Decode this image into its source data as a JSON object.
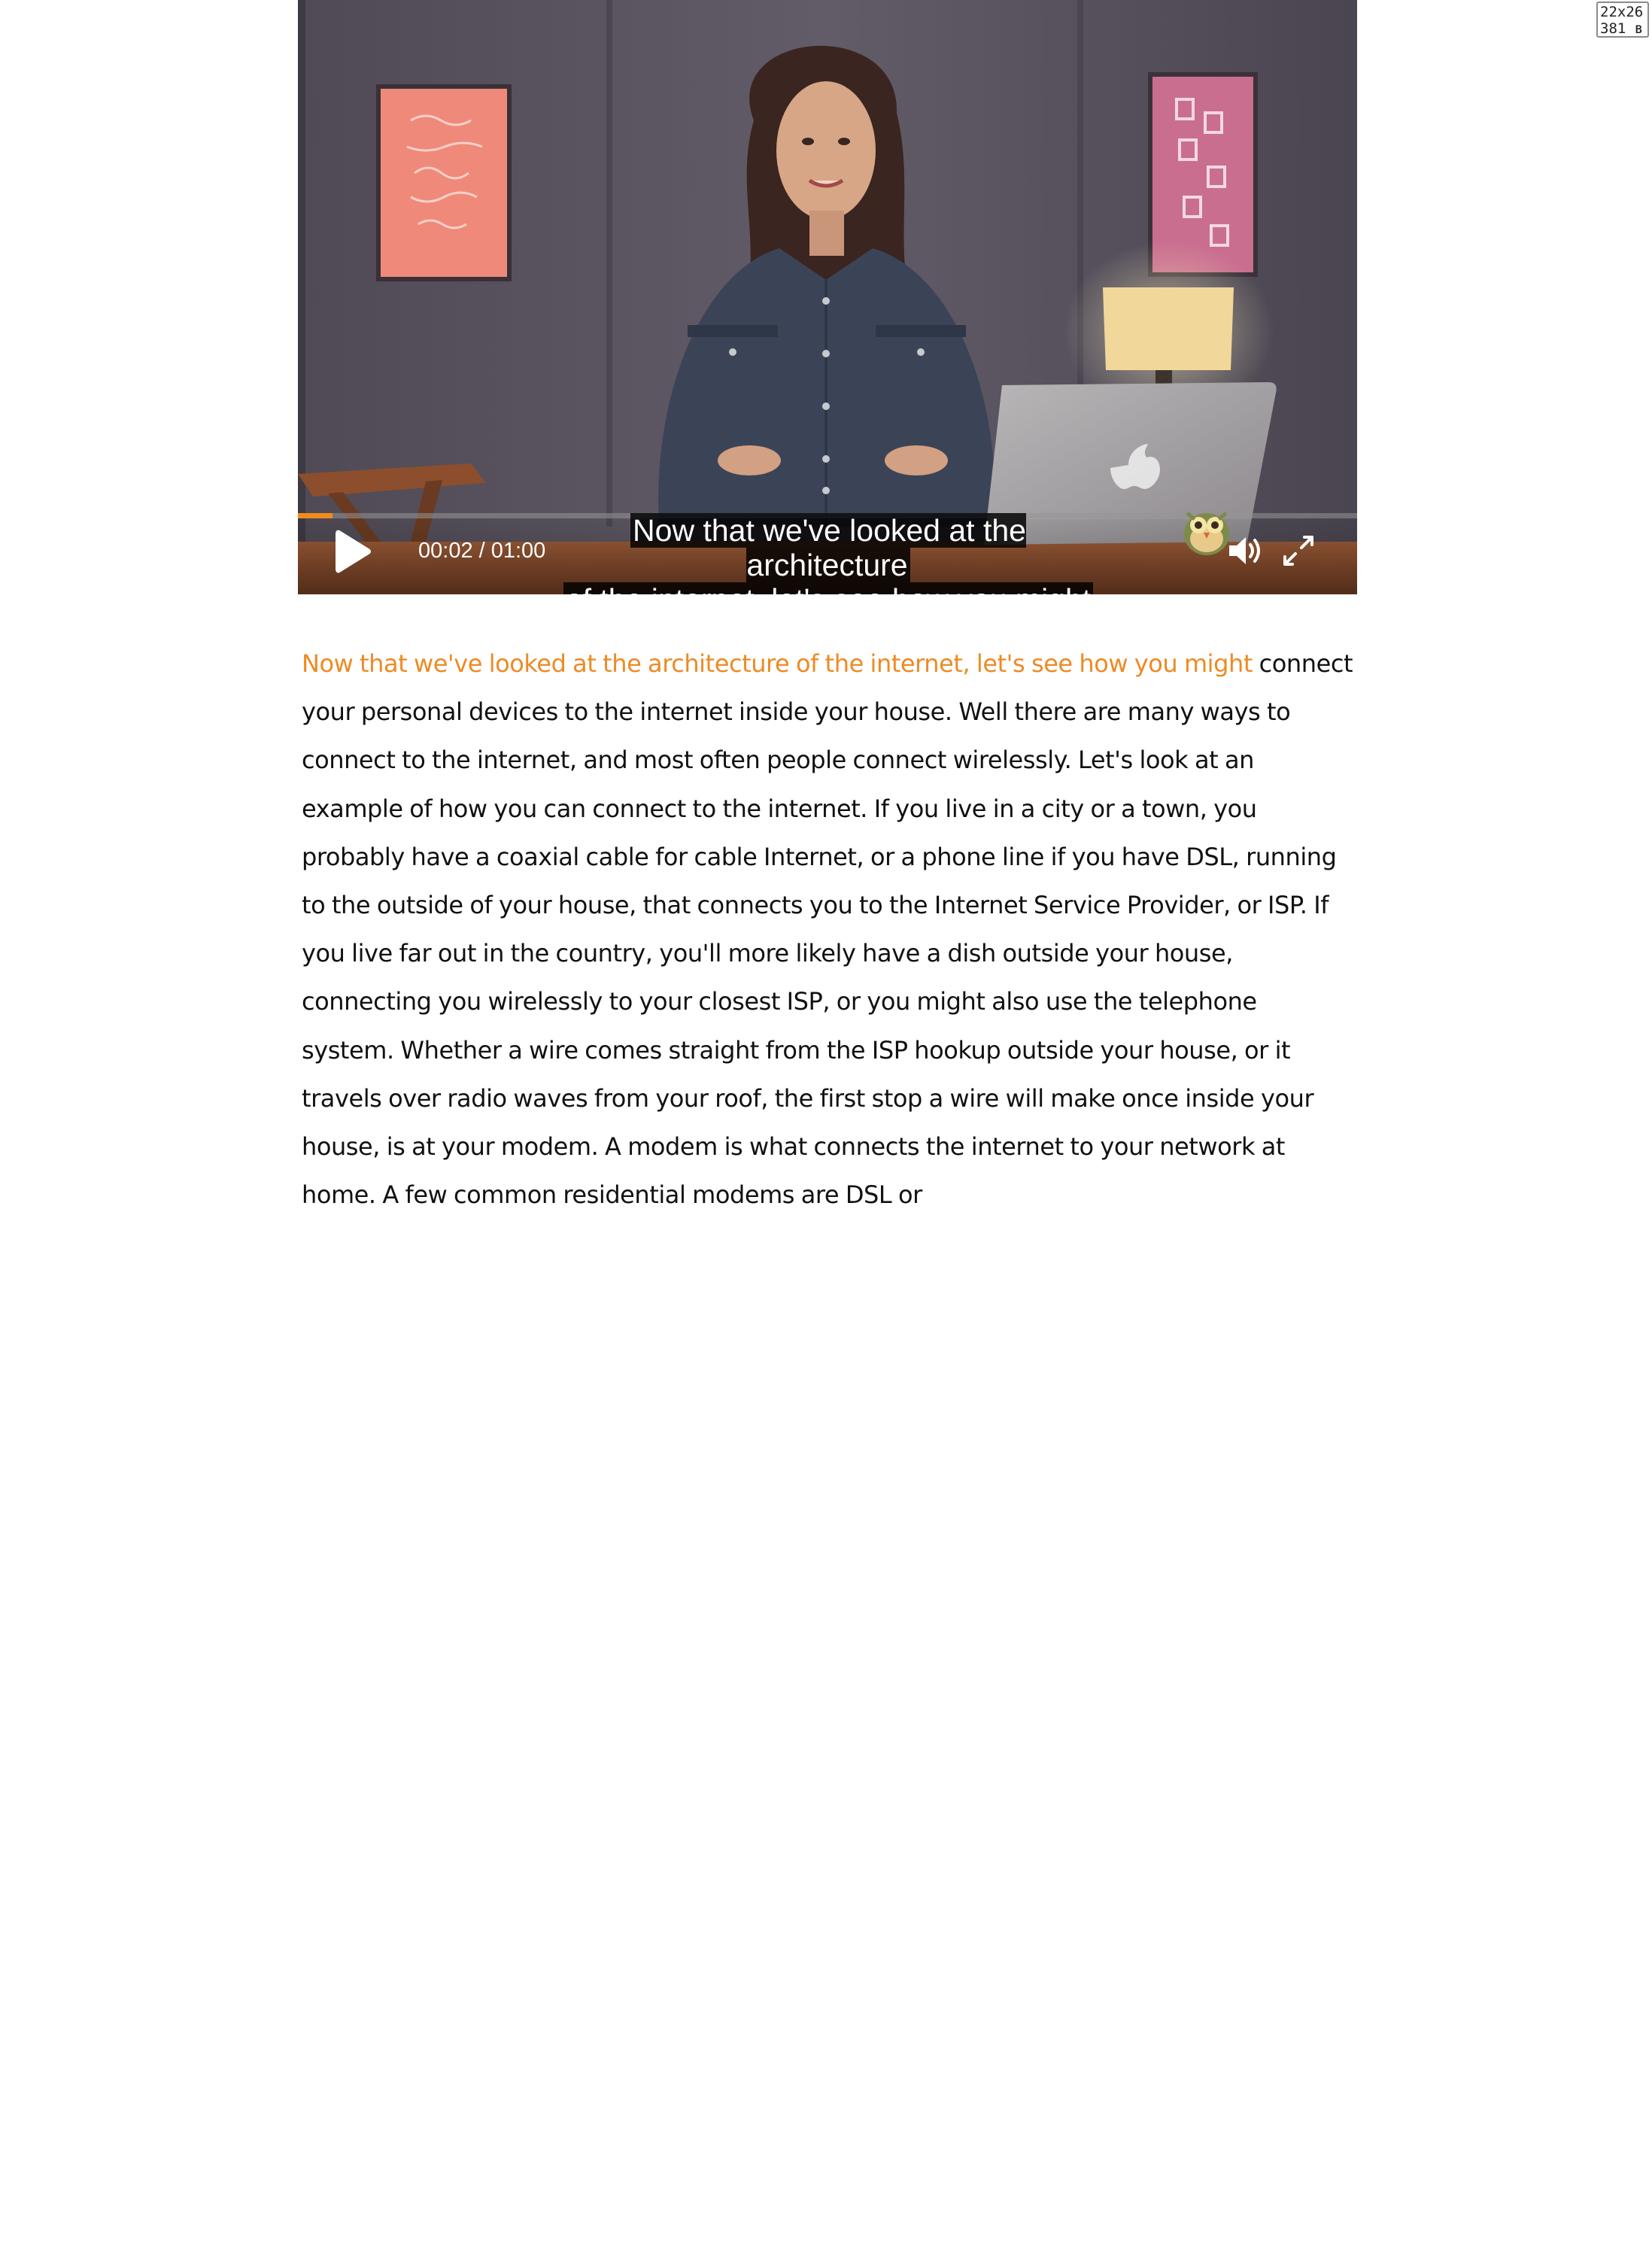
{
  "badge": {
    "line1": "22x26",
    "line2": "381 ʙ"
  },
  "player": {
    "state": "paused",
    "progress_fraction": 0.033,
    "current_time": "00:02",
    "duration": "01:00",
    "time_display": "00:02 / 01:00",
    "caption_lines": [
      "Now that we've looked at the architecture",
      "of the internet, let's see how you might"
    ],
    "accent_color": "#f08c1a",
    "icons": {
      "play": "play-icon",
      "volume": "volume-icon",
      "fullscreen": "fullscreen-icon",
      "watermark": "owl-logo-icon"
    }
  },
  "transcript": {
    "highlight_color": "#ee8a24",
    "highlighted": "Now that we've looked at the architecture of the internet, let's see how you might",
    "rest": " connect your personal devices to the internet inside your house. Well there are many ways to connect to the internet, and most often people connect wirelessly. Let's look at an example of how you can connect to the internet. If you live in a city or a town, you probably have a coaxial cable for cable Internet, or a phone line if you have DSL, running to the outside of your house, that connects you to the Internet Service Provider, or ISP. If you live far out in the country, you'll more likely have a dish outside your house, connecting you wirelessly to your closest ISP, or you might also use the telephone system. Whether a wire comes straight from the ISP hookup outside your house, or it travels over radio waves from your roof, the first stop a wire will make once inside your house, is at your modem. A modem is what connects the internet to your network at home. A few common residential modems are DSL or"
  }
}
